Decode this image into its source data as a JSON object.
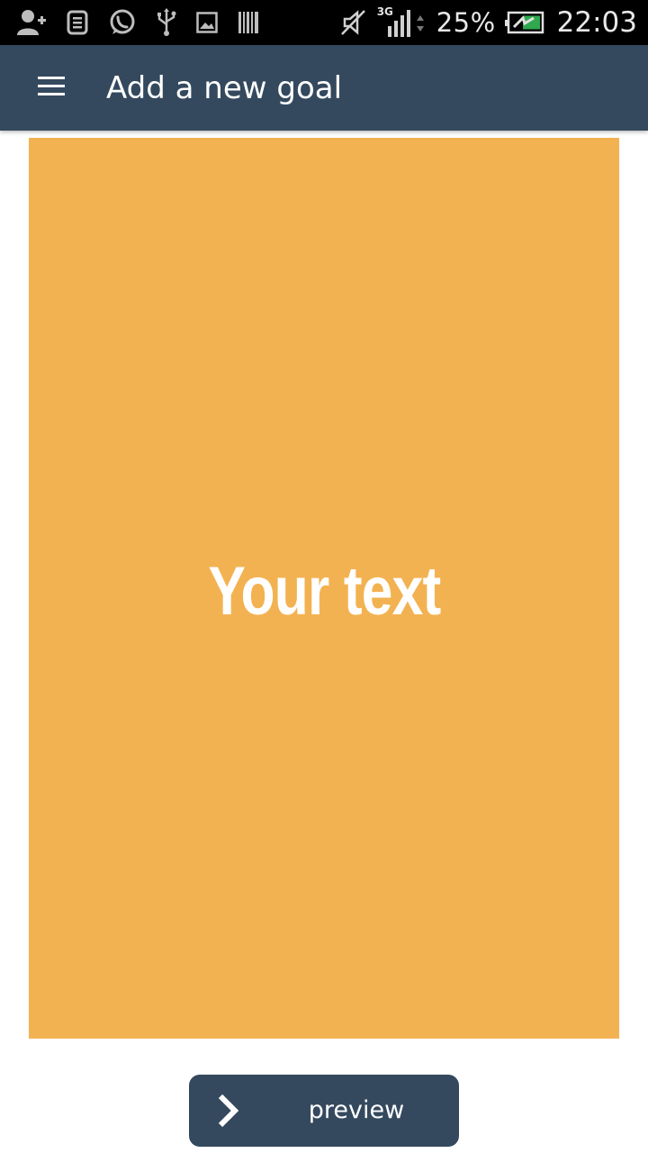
{
  "status_bar": {
    "battery": "25%",
    "time": "22:03",
    "network": "3G",
    "left_icons": [
      "add-contact-icon",
      "sim-toolkit-icon",
      "whatsapp-icon",
      "usb-icon",
      "image-icon",
      "barcode-icon"
    ],
    "right_icons": [
      "silent-mode-icon",
      "signal-icon",
      "battery-icon"
    ]
  },
  "app_bar": {
    "menu_icon": "hamburger-menu-icon",
    "title": "Add a new goal"
  },
  "goal_card": {
    "text": "Your text",
    "background_color": "#f3b251",
    "text_color": "#ffffff"
  },
  "preview_button": {
    "icon": "chevron-right-icon",
    "label": "preview"
  },
  "colors": {
    "app_bar": "#34495e",
    "button": "#34495e",
    "status_bar": "#000000",
    "card": "#f3b251"
  }
}
